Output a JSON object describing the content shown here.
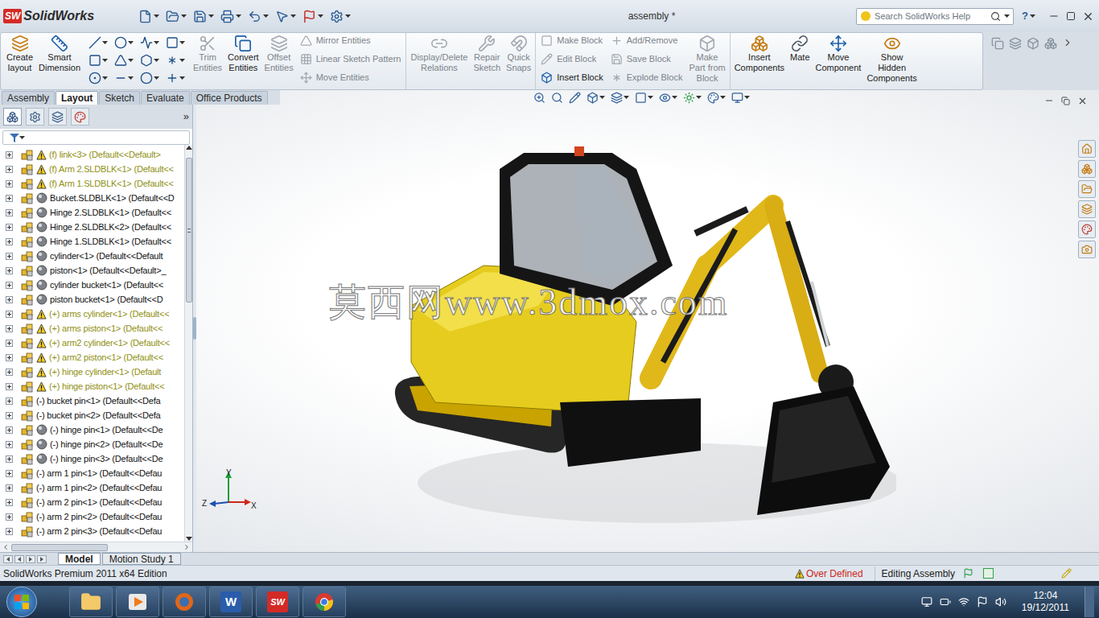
{
  "window": {
    "title": "assembly *",
    "logo": {
      "mark": "SW",
      "name": "SolidWorks"
    }
  },
  "search": {
    "placeholder": "Search SolidWorks Help"
  },
  "help": "?",
  "ribbon": [
    [
      {
        "kind": "big",
        "lines": [
          "Create",
          "layout"
        ],
        "disabled": false
      },
      {
        "kind": "big",
        "lines": [
          "Smart",
          "Dimension"
        ],
        "disabled": false
      },
      {
        "kind": "tools"
      },
      {
        "kind": "big",
        "lines": [
          "Trim",
          "Entities"
        ],
        "disabled": true
      },
      {
        "kind": "big",
        "lines": [
          "Convert",
          "Entities"
        ],
        "disabled": false
      },
      {
        "kind": "big",
        "lines": [
          "Offset",
          "Entities"
        ],
        "disabled": true
      },
      {
        "kind": "column",
        "items": [
          {
            "label": "Mirror Entities",
            "disabled": true
          },
          {
            "label": "Linear Sketch Pattern",
            "disabled": true
          },
          {
            "label": "Move Entities",
            "disabled": true
          }
        ]
      }
    ],
    [
      {
        "kind": "big",
        "lines": [
          "Display/Delete",
          "Relations"
        ],
        "disabled": true
      },
      {
        "kind": "big",
        "lines": [
          "Repair",
          "Sketch"
        ],
        "disabled": true
      },
      {
        "kind": "big",
        "lines": [
          "Quick",
          "Snaps"
        ],
        "disabled": true
      }
    ],
    [
      {
        "kind": "column",
        "items": [
          {
            "label": "Make Block",
            "disabled": true
          },
          {
            "label": "Edit Block",
            "disabled": true
          },
          {
            "label": "Insert Block",
            "disabled": false
          }
        ]
      },
      {
        "kind": "column",
        "items": [
          {
            "label": "Add/Remove",
            "disabled": true
          },
          {
            "label": "Save Block",
            "disabled": true
          },
          {
            "label": "Explode Block",
            "disabled": true
          }
        ]
      },
      {
        "kind": "big",
        "lines": [
          "Make",
          "Part from",
          "Block"
        ],
        "disabled": true
      }
    ],
    [
      {
        "kind": "big",
        "lines": [
          "Insert",
          "Components"
        ],
        "disabled": false
      },
      {
        "kind": "big",
        "lines": [
          "Mate"
        ],
        "disabled": false
      },
      {
        "kind": "big",
        "lines": [
          "Move",
          "Component"
        ],
        "disabled": false
      },
      {
        "kind": "big",
        "lines": [
          "Show",
          "Hidden",
          "Components"
        ],
        "disabled": false
      }
    ]
  ],
  "tabs": [
    {
      "label": "Assembly",
      "selected": false
    },
    {
      "label": "Layout",
      "selected": true
    },
    {
      "label": "Sketch",
      "selected": false
    },
    {
      "label": "Evaluate",
      "selected": false
    },
    {
      "label": "Office Products",
      "selected": false
    }
  ],
  "panel": {
    "collapse": "»"
  },
  "tree": [
    {
      "text": "(f) link<3> (Default<<Default>",
      "kind": "warning",
      "dimmed": true
    },
    {
      "text": "(f) Arm 2.SLDBLK<1> (Default<<",
      "kind": "warning",
      "dimmed": true
    },
    {
      "text": "(f) Arm 1.SLDBLK<1> (Default<<",
      "kind": "warning",
      "dimmed": true
    },
    {
      "text": "Bucket.SLDBLK<1> (Default<<D",
      "kind": "part",
      "dimmed": false
    },
    {
      "text": "Hinge 2.SLDBLK<1> (Default<<",
      "kind": "part",
      "dimmed": false
    },
    {
      "text": "Hinge 2.SLDBLK<2> (Default<<",
      "kind": "part",
      "dimmed": false
    },
    {
      "text": "Hinge 1.SLDBLK<1> (Default<<",
      "kind": "part",
      "dimmed": false
    },
    {
      "text": "cylinder<1> (Default<<Default",
      "kind": "part",
      "dimmed": false
    },
    {
      "text": "piston<1> (Default<<Default>_",
      "kind": "part",
      "dimmed": false
    },
    {
      "text": "cylinder bucket<1> (Default<<",
      "kind": "part",
      "dimmed": false
    },
    {
      "text": "piston bucket<1> (Default<<D",
      "kind": "part",
      "dimmed": false
    },
    {
      "text": "(+) arms cylinder<1> (Default<<",
      "kind": "warning",
      "dimmed": true
    },
    {
      "text": "(+) arms piston<1> (Default<<",
      "kind": "warning",
      "dimmed": true
    },
    {
      "text": "(+) arm2 cylinder<1> (Default<<",
      "kind": "warning",
      "dimmed": true
    },
    {
      "text": "(+) arm2 piston<1> (Default<<",
      "kind": "warning",
      "dimmed": true
    },
    {
      "text": "(+) hinge cylinder<1> (Default",
      "kind": "warning",
      "dimmed": true
    },
    {
      "text": "(+) hinge piston<1> (Default<<",
      "kind": "warning",
      "dimmed": true
    },
    {
      "text": "(-) bucket pin<1> (Default<<Defa",
      "kind": "plain",
      "dimmed": false
    },
    {
      "text": "(-) bucket pin<2> (Default<<Defa",
      "kind": "plain",
      "dimmed": false
    },
    {
      "text": "(-) hinge pin<1> (Default<<De",
      "kind": "part",
      "dimmed": false
    },
    {
      "text": "(-) hinge pin<2> (Default<<De",
      "kind": "part",
      "dimmed": false
    },
    {
      "text": "(-) hinge pin<3> (Default<<De",
      "kind": "part",
      "dimmed": false
    },
    {
      "text": "(-) arm 1 pin<1> (Default<<Defau",
      "kind": "plain",
      "dimmed": false
    },
    {
      "text": "(-) arm 1 pin<2> (Default<<Defau",
      "kind": "plain",
      "dimmed": false
    },
    {
      "text": "(-) arm 2 pin<1> (Default<<Defau",
      "kind": "plain",
      "dimmed": false
    },
    {
      "text": "(-) arm 2 pin<2> (Default<<Defau",
      "kind": "plain",
      "dimmed": false
    },
    {
      "text": "(-) arm 2 pin<3> (Default<<Defau",
      "kind": "plain",
      "dimmed": false
    }
  ],
  "bottom_tabs": [
    {
      "label": "Model",
      "selected": true
    },
    {
      "label": "Motion Study 1",
      "selected": false
    }
  ],
  "viewport": {
    "watermark": "莫西网www.3dmox.com",
    "triad": {
      "y": "Y",
      "z": "Z",
      "x": "X"
    }
  },
  "status_bar": {
    "edition": "SolidWorks Premium 2011 x64 Edition",
    "warning": "Over Defined",
    "mode": "Editing Assembly"
  },
  "taskbar": {
    "apps": [
      {
        "kind": "folder"
      },
      {
        "kind": "media"
      },
      {
        "kind": "firefox"
      },
      {
        "kind": "word",
        "label": "W"
      },
      {
        "kind": "solidworks",
        "label": "SW"
      },
      {
        "kind": "chrome"
      }
    ],
    "time": "12:04",
    "date": "19/12/2011"
  }
}
